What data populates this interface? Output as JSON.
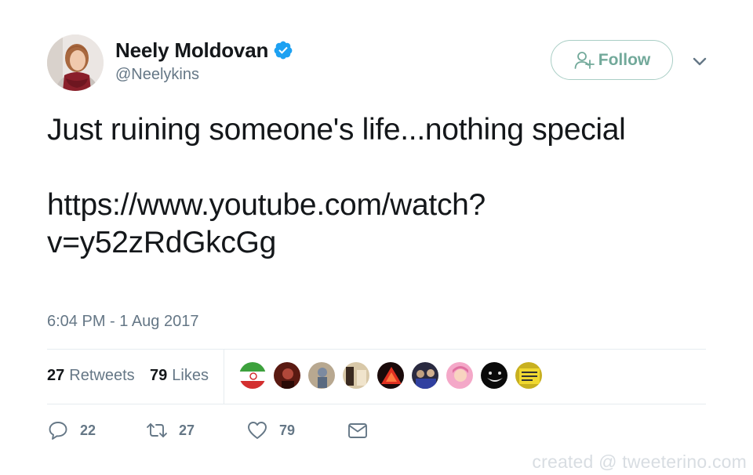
{
  "user": {
    "display_name": "Neely Moldovan",
    "handle": "@Neelykins",
    "verified_icon": "verified-badge-icon",
    "avatar_icon": "profile-photo"
  },
  "follow_button": {
    "label": "Follow",
    "icon": "add-user-icon"
  },
  "menu_icon": "chevron-down-icon",
  "tweet": {
    "line1": "Just ruining someone's life...nothing special",
    "link_line1": "https://www.youtube.com/watch?",
    "link_line2": "v=y52zRdGkcGg",
    "timestamp": "6:04 PM - 1 Aug 2017"
  },
  "stats": {
    "retweets_count": "27",
    "retweets_label": "Retweets",
    "likes_count": "79",
    "likes_label": "Likes"
  },
  "likers": [
    "iran-flag-avatar",
    "red-portrait-avatar",
    "cyclist-avatar",
    "room-avatar",
    "red-triangle-avatar",
    "group-avatar",
    "pink-hair-avatar",
    "dark-face-avatar",
    "protest-sign-avatar"
  ],
  "actions": {
    "reply_count": "22",
    "retweet_count": "27",
    "like_count": "79"
  },
  "watermark": "created @ tweeterino.com",
  "colors": {
    "text": "#14171a",
    "secondary": "#657786",
    "follow": "#72a99a",
    "verified": "#1da1f2",
    "divider": "#e6ecf0"
  }
}
